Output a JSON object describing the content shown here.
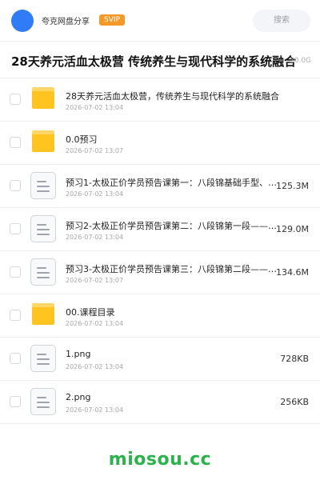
{
  "header": {
    "app_name": "夸克网盘分享",
    "badge": "SVIP",
    "search_placeholder": "搜索"
  },
  "page": {
    "title": "28天养元活血太极营 传统养生与现代科学的系统融合",
    "total_size": "20.0G"
  },
  "files": [
    {
      "type": "folder",
      "name": "28天养元活血太极营，传统养生与现代科学的系统融合",
      "date": "2026-07-02 13:04",
      "size": ""
    },
    {
      "type": "folder",
      "name": "0.0预习",
      "date": "2026-07-02 13:07",
      "size": ""
    },
    {
      "type": "file",
      "name": "预习1-太极正价学员预告课第一：八段锦基础手型、步型…",
      "date": "2026-07-02 13:04",
      "size": "125.3M"
    },
    {
      "type": "file",
      "name": "预习2-太极正价学员预告课第二：八段锦第一段——双手…",
      "date": "2026-07-02 13:04",
      "size": "129.0M"
    },
    {
      "type": "file",
      "name": "预习3-太极正价学员预告课第三：八段锦第二段——左右…",
      "date": "2026-07-02 13:07",
      "size": "134.6M"
    },
    {
      "type": "folder",
      "name": "00.课程目录",
      "date": "2026-07-02 13:04",
      "size": ""
    },
    {
      "type": "file",
      "name": "1.png",
      "date": "2026-07-02 13:04",
      "size": "728KB"
    },
    {
      "type": "file",
      "name": "2.png",
      "date": "2026-07-02 13:04",
      "size": "256KB"
    }
  ],
  "watermark": "miosou.cc",
  "colors": {
    "avatar": "#2f7cf6",
    "badge": "#f59a2a",
    "folder": "#ffc41f",
    "watermark": "#2bb24c"
  }
}
